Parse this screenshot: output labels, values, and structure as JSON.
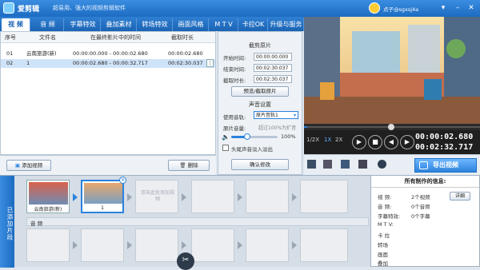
{
  "app": {
    "name": "爱剪辑",
    "slogan": "超易用、强大的视频剪辑软件",
    "username": "点子@sgxsj4a"
  },
  "tabs": [
    {
      "label": "视  频",
      "active": true
    },
    {
      "label": "音  频"
    },
    {
      "label": "字幕特效"
    },
    {
      "label": "叠加素材"
    },
    {
      "label": "转场特效"
    },
    {
      "label": "画面风格"
    },
    {
      "label": "M T V"
    },
    {
      "label": "卡拉OK"
    },
    {
      "label": "升级与服务"
    }
  ],
  "clip_list": {
    "headers": [
      "序号",
      "文件名",
      "在最终影片中的时间",
      "截取时长"
    ],
    "rows": [
      {
        "index": "01",
        "name": "云南旅游(新)",
        "time": "00:00:00.000 - 00:00:02.680",
        "duration": "00:00:02.680",
        "selected": false
      },
      {
        "index": "02",
        "name": "1",
        "time": "00:00:02.680 - 00:00:32.717",
        "duration": "00:02:30.037",
        "selected": true
      }
    ]
  },
  "cut": {
    "title": "截剪原片",
    "start_label": "开始时间:",
    "start_value": "00:00:00.000",
    "end_label": "结束时间:",
    "end_value": "00:02:30.037",
    "duration_label": "截取时长:",
    "duration_value": "00:02:30.037",
    "preview_button": "预览/截取原片"
  },
  "sound": {
    "title": "声音设置",
    "track_label": "使用音轨:",
    "track_value": "原片音轨1",
    "volume_label": "原片音量:",
    "volume_hint": "超过100%为扩音",
    "volume_value": "100%",
    "volume_level": 0.35,
    "fade_label": "头尾声音淡入淡出",
    "confirm_button": "确认修改"
  },
  "playback": {
    "speeds": [
      "1/2X",
      "1X",
      "2X"
    ],
    "current_time": "00:00:02.680",
    "total_time": "00:02:32.717",
    "progress": 0.02
  },
  "export_button": "导出视频",
  "add_video_button": "添加视频",
  "delete_button": "删除",
  "timeline": {
    "side_label": "已添加片段",
    "clips": [
      {
        "caption": "云南旅游(新)"
      },
      {
        "caption": "1"
      }
    ],
    "placeholder": "双击此处添加视频",
    "audio_label": "音 频"
  },
  "info": {
    "title": "所有制作的信息:",
    "rows": [
      {
        "label": "视  频:",
        "value": "2个视频"
      },
      {
        "label": "音  频:",
        "value": "0个音频"
      },
      {
        "label": "字幕特效:",
        "value": "0个字幕"
      },
      {
        "label": "M  T  V:",
        "value": ""
      },
      {
        "label": "卡  拉",
        "value": ""
      },
      {
        "label": "转场",
        "value": ""
      },
      {
        "label": "画面",
        "value": ""
      },
      {
        "label": "叠加",
        "value": ""
      }
    ],
    "detail_button": "详细"
  },
  "colors": {
    "accent": "#2b82dd",
    "titlebar": "#1c6cc2",
    "selected_row": "#cfe3f8"
  }
}
